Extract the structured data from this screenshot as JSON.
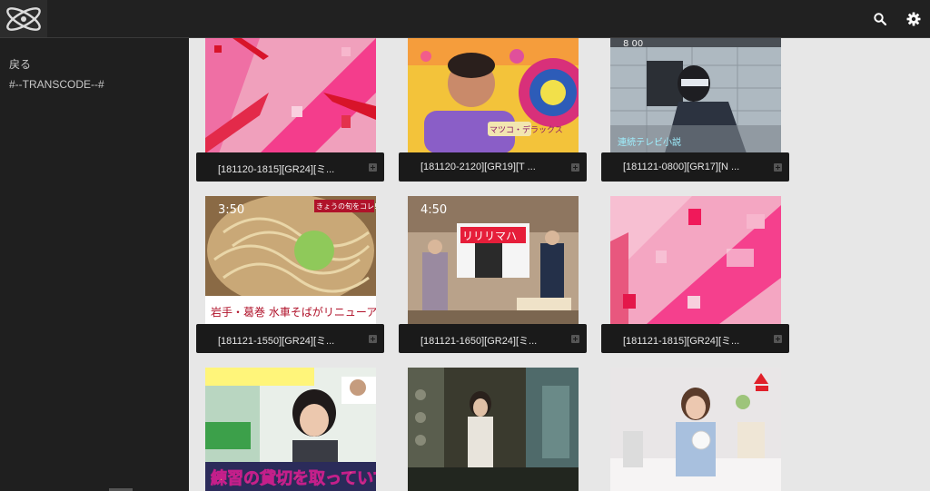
{
  "header": {
    "logo_icon": "atom-logo-icon",
    "search_icon": "search-icon",
    "settings_icon": "gear-icon"
  },
  "sidebar": {
    "items": [
      {
        "label": "戻る"
      },
      {
        "label": "#--TRANSCODE--#"
      }
    ]
  },
  "cards": [
    {
      "title": "[181120-1815][GR24][ミ...",
      "theme": "pink"
    },
    {
      "title": "[181120-2120][GR19][T ...",
      "theme": "candy"
    },
    {
      "title": "[181121-0800][GR17][N ...",
      "theme": "kitchen",
      "badge": "8 00"
    },
    {
      "title": "[181121-1550][GR24][ミ...",
      "theme": "noodle",
      "badge": "3:50",
      "caption": "岩手・葛巻 水車そばがリニューアル!"
    },
    {
      "title": "[181121-1650][GR24][ミ...",
      "theme": "studio",
      "badge": "4:50"
    },
    {
      "title": "[181121-1815][GR24][ミ...",
      "theme": "pink"
    },
    {
      "title": "",
      "theme": "skate",
      "caption": "練習の貸切を取っていて"
    },
    {
      "title": "",
      "theme": "cafe"
    },
    {
      "title": "",
      "theme": "white"
    }
  ]
}
